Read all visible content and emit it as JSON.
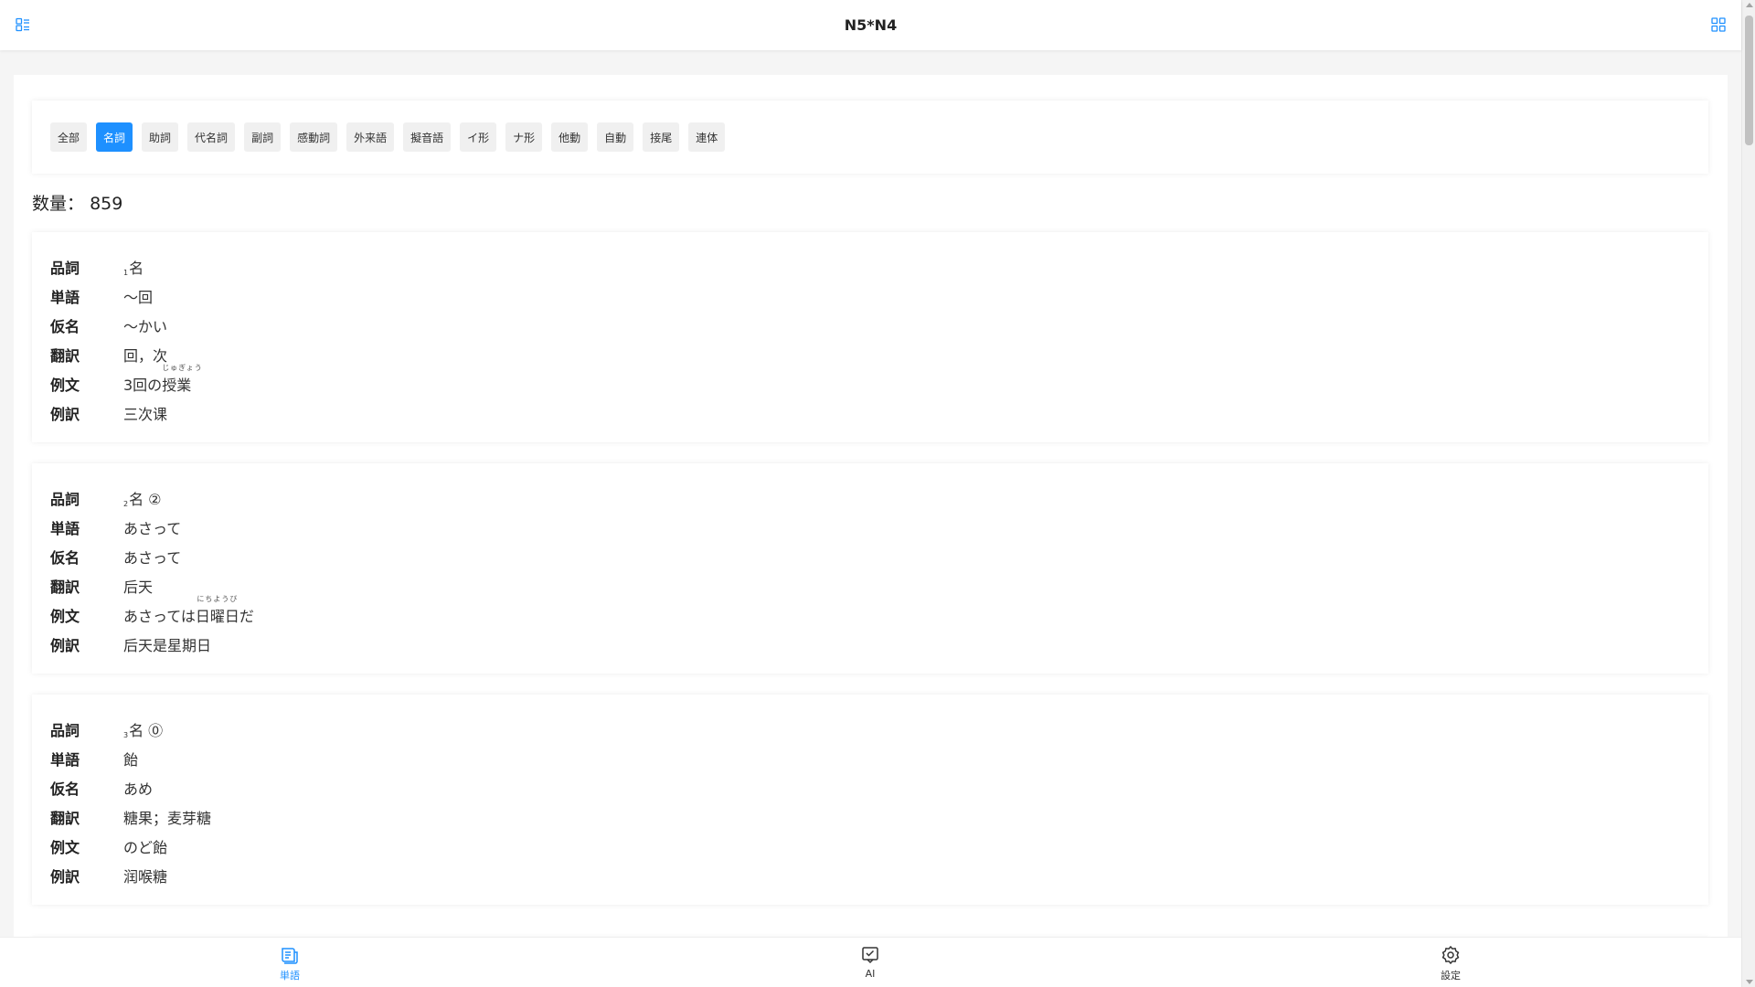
{
  "header": {
    "title": "N5*N4"
  },
  "filters": [
    {
      "label": "全部",
      "active": false
    },
    {
      "label": "名詞",
      "active": true
    },
    {
      "label": "助詞",
      "active": false
    },
    {
      "label": "代名詞",
      "active": false
    },
    {
      "label": "副詞",
      "active": false
    },
    {
      "label": "感動詞",
      "active": false
    },
    {
      "label": "外来語",
      "active": false
    },
    {
      "label": "擬音語",
      "active": false
    },
    {
      "label": "イ形",
      "active": false
    },
    {
      "label": "ナ形",
      "active": false
    },
    {
      "label": "他動",
      "active": false
    },
    {
      "label": "自動",
      "active": false
    },
    {
      "label": "接尾",
      "active": false
    },
    {
      "label": "連体",
      "active": false
    }
  ],
  "count": {
    "label": "数量：",
    "value": "859"
  },
  "field_labels": {
    "pos": "品詞",
    "word": "単語",
    "kana": "仮名",
    "translation": "翻訳",
    "example": "例文",
    "example_translation": "例訳"
  },
  "cards": [
    {
      "index": "1",
      "pos": "名",
      "word": "〜回",
      "kana": "〜かい",
      "translation": "回，次",
      "example_pre": "3回の",
      "example_ruby_base": "授業",
      "example_ruby_text": "じゅぎょう",
      "example_post": "",
      "example_translation": "三次课"
    },
    {
      "index": "2",
      "pos": "名 ②",
      "word": "あさって",
      "kana": "あさって",
      "translation": "后天",
      "example_pre": "あさっては",
      "example_ruby_base": "日曜日",
      "example_ruby_text": "にちようび",
      "example_post": "だ",
      "example_translation": "后天是星期日"
    },
    {
      "index": "3",
      "pos": "名 ⓪",
      "word": "飴",
      "kana": "あめ",
      "translation": "糖果；麦芽糖",
      "example_pre": "のど飴",
      "example_ruby_base": "",
      "example_ruby_text": "",
      "example_post": "",
      "example_translation": "润喉糖"
    }
  ],
  "nav": [
    {
      "label": "単語",
      "icon": "word-book-icon",
      "active": true
    },
    {
      "label": "AI",
      "icon": "ai-chat-icon",
      "active": false
    },
    {
      "label": "設定",
      "icon": "settings-gear-icon",
      "active": false
    }
  ],
  "colors": {
    "accent": "#1e90ff",
    "background": "#f5f5f5"
  }
}
